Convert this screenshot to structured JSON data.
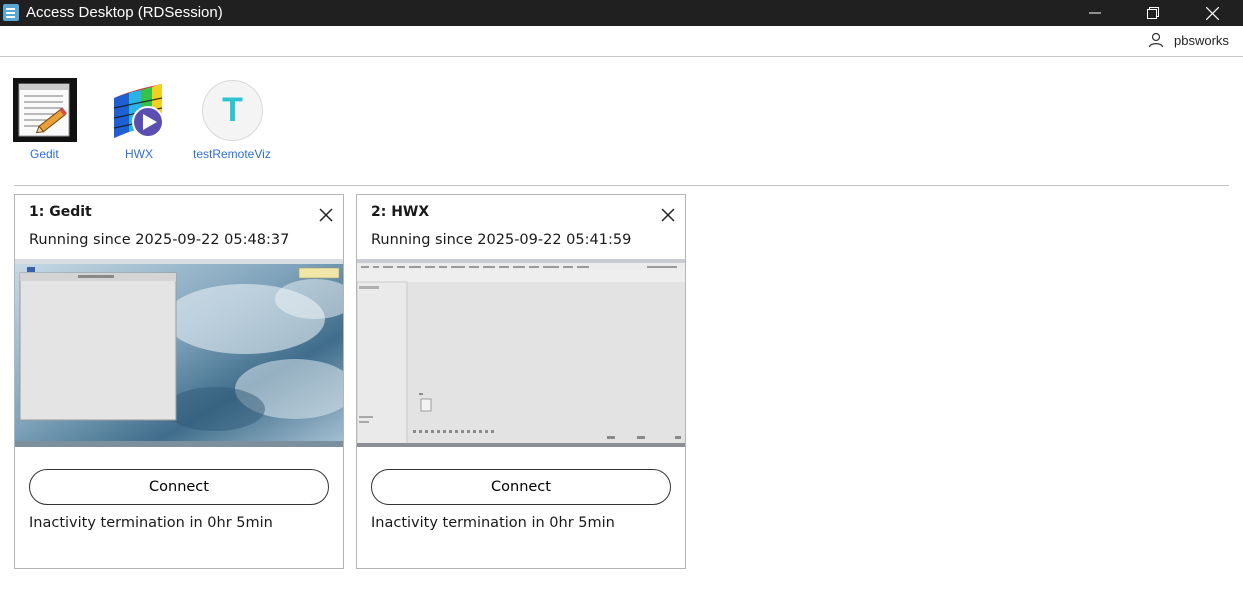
{
  "window": {
    "title": "Access Desktop (RDSession)"
  },
  "user": {
    "name": "pbsworks"
  },
  "launcher": [
    {
      "label": "Gedit"
    },
    {
      "label": "HWX"
    },
    {
      "label": "testRemoteViz",
      "icon_letter": "T"
    }
  ],
  "sessions": [
    {
      "title": "1: Gedit",
      "status": "Running since 2025-09-22 05:48:37",
      "connect_label": "Connect",
      "inactivity": "Inactivity termination in 0hr 5min"
    },
    {
      "title": "2: HWX",
      "status": "Running since 2025-09-22 05:41:59",
      "connect_label": "Connect",
      "inactivity": "Inactivity termination in 0hr 5min"
    }
  ],
  "colors": {
    "titlebar_bg": "#202020",
    "link_blue": "#2f6fd6",
    "accent_teal": "#2ec4cf"
  }
}
